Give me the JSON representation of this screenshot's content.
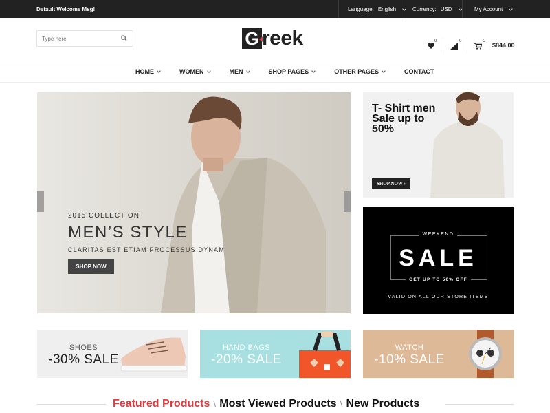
{
  "topbar": {
    "welcome": "Default Welcome Msg!",
    "language_label": "Language:",
    "language_value": "English",
    "currency_label": "Currency:",
    "currency_value": "USD",
    "account_label": "My Account"
  },
  "header": {
    "search_placeholder": "Type here",
    "logo_initial": "G",
    "logo_rest": "reek",
    "wishlist_count": "0",
    "compare_count": "0",
    "cart_count": "2",
    "cart_total": "$844.00",
    "accent_color": "#e8363c"
  },
  "nav": {
    "items": [
      {
        "label": "HOME",
        "dropdown": true
      },
      {
        "label": "WOMEN",
        "dropdown": true
      },
      {
        "label": "MEN",
        "dropdown": true
      },
      {
        "label": "SHOP PAGES",
        "dropdown": true
      },
      {
        "label": "OTHER PAGES",
        "dropdown": true
      },
      {
        "label": "CONTACT",
        "dropdown": false
      }
    ]
  },
  "hero": {
    "collection": "2015 COLLECTION",
    "title": "MEN’S STYLE",
    "subtitle": "CLARITAS EST ETIAM PROCESSUS DYNAM",
    "button": "SHOP NOW"
  },
  "tshirt_banner": {
    "title": "T- Shirt men Sale up to 50%",
    "button": "SHOP NOW"
  },
  "sale_banner": {
    "kicker": "WEEKEND",
    "title": "SALE",
    "offer": "GET UP TO 50% OFF",
    "note": "VALID ON ALL OUR STORE ITEMS"
  },
  "categories": [
    {
      "name": "SHOES",
      "deal": "-30% SALE",
      "bg": "#efefef"
    },
    {
      "name": "HAND BAGS",
      "deal": "-20% SALE",
      "bg": "#a8dfe0"
    },
    {
      "name": "WATCH",
      "deal": "-10% SALE",
      "bg": "#deb998"
    }
  ],
  "product_tabs": {
    "items": [
      "Featured Products",
      "Most Viewed Products",
      "New Products"
    ],
    "active_index": 0,
    "active_color": "#e8363c"
  }
}
